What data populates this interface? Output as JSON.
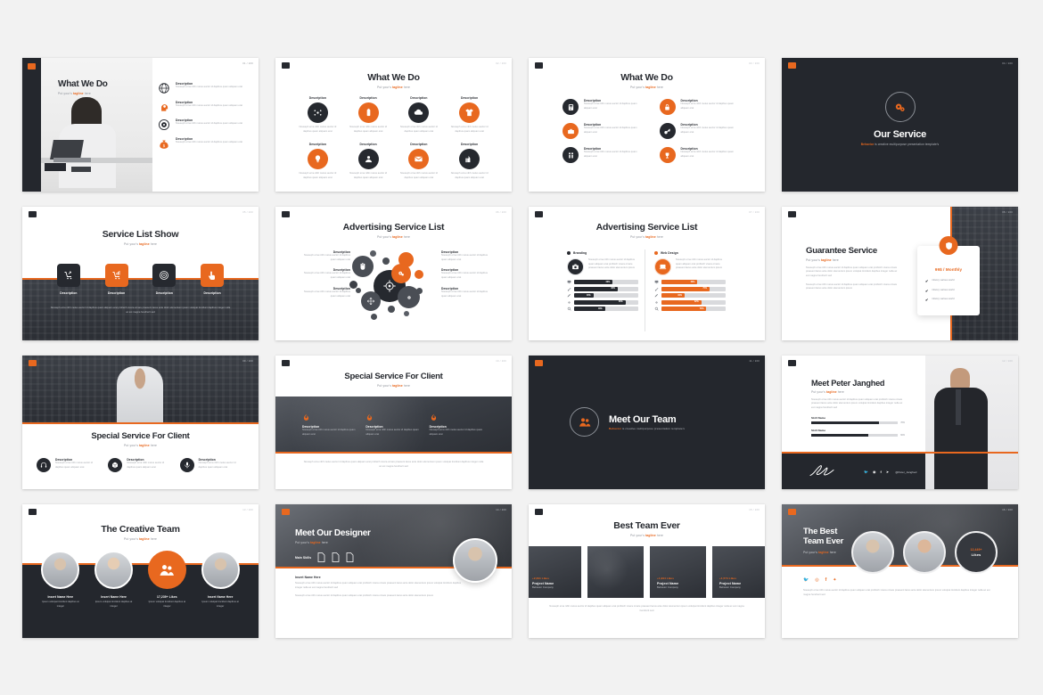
{
  "meta": {
    "background": "#f2f2f2",
    "accent": "#e8681f",
    "dark": "#24272d",
    "columns": 4,
    "rows": 4
  },
  "common": {
    "logo_icon": "brand-logo-icon",
    "subtitle_prefix": "Put your's ",
    "subtitle_accent": "tagline",
    "subtitle_suffix": " here",
    "description_label": "Description",
    "lorem_short": "Nouseph erna nibh metus auctor id dapibus quam aliquam erat",
    "lorem_med": "Nouseph erna nibh metus auctor id dapibus quam aliquam erat profisich vivera ornare praesent lacus ante dolor elementum ipsum",
    "lorem_long": "Nouseph erna nibh metus auctor id dapibus quam aliquam erat profisich vivera ornare praesent lacus ante dolor elementum ipsum volutpat tincidunt dapibus integer nulla ac est magna hendrerit sed"
  },
  "slides": [
    {
      "id": 1,
      "page": "01 / 100",
      "title": "What We Do",
      "layout": "photo-left-icon-list",
      "items": [
        {
          "label": "Description",
          "icon": "globe-network-icon",
          "color": "dark"
        },
        {
          "label": "Description",
          "icon": "head-gear-icon",
          "color": "orange"
        },
        {
          "label": "Description",
          "icon": "target-gear-icon",
          "color": "dark"
        },
        {
          "label": "Description",
          "icon": "money-bag-icon",
          "color": "orange"
        }
      ]
    },
    {
      "id": 2,
      "page": "02 / 100",
      "title": "What We Do",
      "layout": "icon-grid-8",
      "items": [
        {
          "label": "Description",
          "icon": "network-nodes-icon",
          "color": "dark"
        },
        {
          "label": "Description",
          "icon": "battery-icon",
          "color": "orange"
        },
        {
          "label": "Description",
          "icon": "cloud-icon",
          "color": "dark"
        },
        {
          "label": "Description",
          "icon": "shirt-icon",
          "color": "orange"
        },
        {
          "label": "Description",
          "icon": "bulb-idea-icon",
          "color": "orange"
        },
        {
          "label": "Description",
          "icon": "user-support-icon",
          "color": "dark"
        },
        {
          "label": "Description",
          "icon": "mail-icon",
          "color": "orange"
        },
        {
          "label": "Description",
          "icon": "thumb-up-icon",
          "color": "dark"
        }
      ]
    },
    {
      "id": 3,
      "page": "03 / 100",
      "title": "What We Do",
      "layout": "icon-list-2col",
      "items": [
        {
          "label": "Description",
          "icon": "calculator-icon",
          "color": "dark"
        },
        {
          "label": "Description",
          "icon": "lock-icon",
          "color": "orange"
        },
        {
          "label": "Description",
          "icon": "briefcase-icon",
          "color": "orange"
        },
        {
          "label": "Description",
          "icon": "key-icon",
          "color": "dark"
        },
        {
          "label": "Description",
          "icon": "people-icon",
          "color": "dark"
        },
        {
          "label": "Description",
          "icon": "trophy-icon",
          "color": "orange"
        }
      ]
    },
    {
      "id": 4,
      "page": "04 / 100",
      "title": "Our Service",
      "layout": "section-divider",
      "icon": "gears-icon",
      "tagline_brand": "Behavior",
      "tagline_rest": " is creative multipurpose presentation template's"
    },
    {
      "id": 5,
      "page": "05 / 100",
      "title": "Service List Show",
      "layout": "four-square-icons-on-photo",
      "items": [
        {
          "label": "Description",
          "icon": "cart-arrow-icon",
          "color": "dark"
        },
        {
          "label": "Description",
          "icon": "cart-chart-icon",
          "color": "orange"
        },
        {
          "label": "Description",
          "icon": "target-icon",
          "color": "dark"
        },
        {
          "label": "Description",
          "icon": "click-hand-icon",
          "color": "orange"
        }
      ]
    },
    {
      "id": 6,
      "page": "06 / 100",
      "title": "Advertising Service List",
      "layout": "bubble-cluster",
      "items": [
        {
          "label": "Description",
          "side": "left"
        },
        {
          "label": "Description",
          "side": "left"
        },
        {
          "label": "Description",
          "side": "left"
        },
        {
          "label": "Description",
          "side": "right"
        },
        {
          "label": "Description",
          "side": "right"
        },
        {
          "label": "Description",
          "side": "right"
        }
      ]
    },
    {
      "id": 7,
      "page": "07 / 100",
      "title": "Advertising Service List",
      "layout": "two-column-bars",
      "groups": [
        {
          "label": "Branding",
          "color": "dark",
          "icon": "camera-badge-icon",
          "bars": [
            {
              "icon": "monitor-icon",
              "value": 60,
              "pct": "60%"
            },
            {
              "icon": "brush-icon",
              "value": 68,
              "pct": "68%"
            },
            {
              "icon": "pen-icon",
              "value": 30,
              "pct": "30%"
            },
            {
              "icon": "gear-icon",
              "value": 80,
              "pct": "80%"
            },
            {
              "icon": "search-icon",
              "value": 48,
              "pct": "48%"
            }
          ]
        },
        {
          "label": "Web Design",
          "color": "orange",
          "icon": "laptop-icon",
          "bars": [
            {
              "icon": "monitor-icon",
              "value": 56,
              "pct": "56%"
            },
            {
              "icon": "brush-icon",
              "value": 75,
              "pct": "75%"
            },
            {
              "icon": "pen-icon",
              "value": 36,
              "pct": "36%"
            },
            {
              "icon": "gear-icon",
              "value": 62,
              "pct": "62%"
            },
            {
              "icon": "search-icon",
              "value": 70,
              "pct": "70%"
            }
          ]
        }
      ]
    },
    {
      "id": 8,
      "page": "08 / 100",
      "title": "Guarantee Service",
      "layout": "text-left-price-card",
      "price": "99$ / Monthly",
      "card_icon": "shield-icon",
      "features": [
        "infancy various world",
        "infancy various world",
        "infancy various world"
      ]
    },
    {
      "id": 9,
      "page": "09 / 100",
      "title": "Special Service For Client",
      "layout": "photo-top-icons-bottom",
      "items": [
        {
          "label": "Description",
          "icon": "headset-icon"
        },
        {
          "label": "Description",
          "icon": "package-icon"
        },
        {
          "label": "Description",
          "icon": "microphone-icon"
        }
      ]
    },
    {
      "id": 10,
      "page": "10 / 100",
      "title": "Special Service For Client",
      "layout": "title-top-photo-cards",
      "items": [
        {
          "label": "Description",
          "icon": "flame-icon"
        },
        {
          "label": "Description",
          "icon": "flame-icon"
        },
        {
          "label": "Description",
          "icon": "flame-icon"
        }
      ]
    },
    {
      "id": 11,
      "page": "11 / 100",
      "title": "Meet Our Team",
      "layout": "section-divider-left",
      "icon": "team-people-icon",
      "tagline_brand": "Behavior",
      "tagline_rest": " is creative multipurpose presentation template's"
    },
    {
      "id": 12,
      "page": "12 / 100",
      "title": "Meet Peter Janghed",
      "layout": "profile-skills",
      "skills": [
        {
          "label": "Skill Name",
          "value": 78,
          "pct": "78%"
        },
        {
          "label": "Skill Name",
          "value": 66,
          "pct": "66%"
        }
      ],
      "handle": "@Peter_Janghed",
      "signature": "signature-mark",
      "socials": [
        "twitter-icon",
        "dribbble-icon",
        "facebook-icon",
        "send-icon"
      ]
    },
    {
      "id": 13,
      "page": "13 / 100",
      "title": "The Creative Team",
      "layout": "team-circles",
      "members": [
        {
          "name": "Insert Name Here",
          "role": "Ipsum volutpat tincidunt dapibus at integer",
          "type": "avatar"
        },
        {
          "name": "Insert Name Here",
          "role": "Ipsum volutpat tincidunt dapibus at integer",
          "type": "avatar"
        },
        {
          "name": "17,239+ Likes",
          "role": "Ipsum volutpat tincidunt dapibus at integer",
          "type": "badge",
          "icon": "team-people-icon"
        },
        {
          "name": "Insert Name Here",
          "role": "Ipsum volutpat tincidunt dapibus at integer",
          "type": "avatar"
        }
      ]
    },
    {
      "id": 14,
      "page": "14 / 100",
      "title": "Meet Our Designer",
      "layout": "designer-hero",
      "skills_label": "Main Skills",
      "skill_icons": [
        "file-psd-icon",
        "file-ai-icon",
        "file-doc-icon"
      ],
      "name_label": "Insert Name Here"
    },
    {
      "id": 15,
      "page": "15 / 100",
      "title": "Best Team Ever",
      "layout": "project-cards",
      "cards": [
        {
          "likes": "+2,391 Likes",
          "name": "Project Name",
          "company": "Behavior Company",
          "type": "dark"
        },
        {
          "likes": "",
          "name": "",
          "company": "",
          "type": "photo"
        },
        {
          "likes": "+1,994 Likes",
          "name": "Project Name",
          "company": "Behavior Company",
          "type": "dark"
        },
        {
          "likes": "+1,574 Likes",
          "name": "Project Name",
          "company": "Behavior Company",
          "type": "dark"
        }
      ]
    },
    {
      "id": 16,
      "page": "16 / 100",
      "title_line1": "The Best",
      "title_line2": "Team Ever",
      "layout": "hero-team-circles",
      "badge_count": "12,449+",
      "badge_label": "Likes",
      "socials": [
        "twitter-icon",
        "pinterest-icon",
        "facebook-icon",
        "dribbble-icon"
      ]
    }
  ]
}
